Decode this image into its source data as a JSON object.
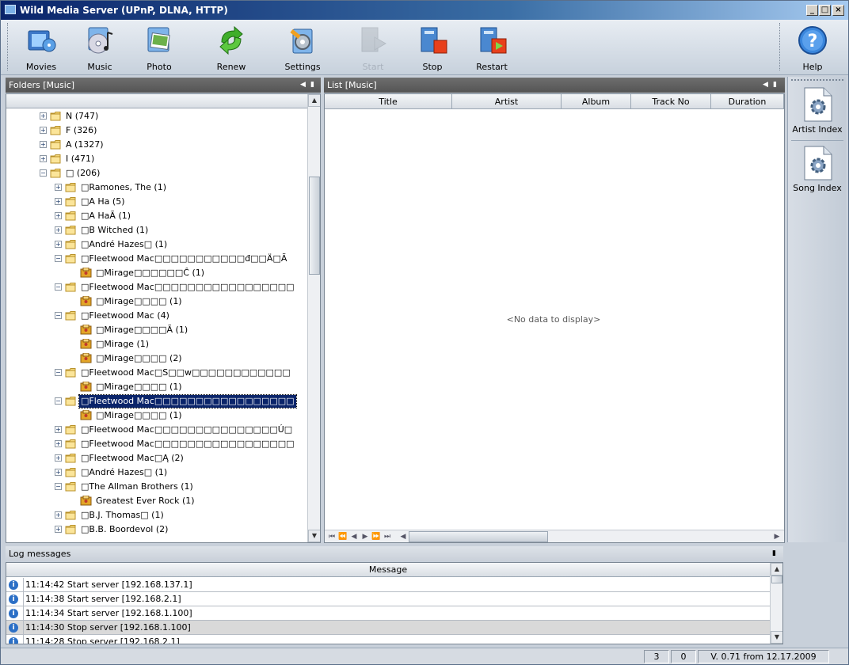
{
  "window": {
    "title": "Wild Media Server (UPnP, DLNA, HTTP)",
    "min_label": "_",
    "max_label": "□",
    "close_label": "×"
  },
  "toolbar": {
    "items": [
      {
        "label": "Movies",
        "icon": "film-icon",
        "enabled": true
      },
      {
        "label": "Music",
        "icon": "music-disc-icon",
        "enabled": true
      },
      {
        "label": "Photo",
        "icon": "photo-icon",
        "enabled": true
      },
      {
        "label": "Renew",
        "icon": "green-arrows-icon",
        "enabled": true
      },
      {
        "label": "Settings",
        "icon": "settings-wrench-icon",
        "enabled": true
      },
      {
        "label": "Start",
        "icon": "start-play-icon",
        "enabled": false
      },
      {
        "label": "Stop",
        "icon": "stop-icon",
        "enabled": true
      },
      {
        "label": "Restart",
        "icon": "restart-icon",
        "enabled": true
      }
    ],
    "help_label": "Help"
  },
  "folders_panel": {
    "title": "Folders [Music]",
    "rows": [
      {
        "label": "N (747)",
        "expander": "+"
      },
      {
        "label": "F (326)",
        "expander": "+"
      },
      {
        "label": "A (1327)",
        "expander": "+"
      },
      {
        "label": "I (471)",
        "expander": "+"
      },
      {
        "label": "□ (206)",
        "expander": "-"
      },
      {
        "label": "□Ramones, The (1)",
        "expander": "+"
      },
      {
        "label": "□A Ha (5)",
        "expander": "+"
      },
      {
        "label": "□A HaÃ (1)",
        "expander": "+"
      },
      {
        "label": "□B Witched (1)",
        "expander": "+"
      },
      {
        "label": "□André Hazes□ (1)",
        "expander": "+"
      },
      {
        "label": "□Fleetwood Mac□□□□□□□□□□□đ□□Ä□Ã",
        "expander": "-"
      },
      {
        "label": "□Mirage□□□□□□Ĉ (1)",
        "expander": ""
      },
      {
        "label": "□Fleetwood Mac□□□□□□□□□□□□□□□□□",
        "expander": "-"
      },
      {
        "label": "□Mirage□□□□ (1)",
        "expander": ""
      },
      {
        "label": "□Fleetwood Mac (4)",
        "expander": "-"
      },
      {
        "label": "□Mirage□□□□Ã (1)",
        "expander": ""
      },
      {
        "label": "□Mirage (1)",
        "expander": ""
      },
      {
        "label": "□Mirage□□□□ (2)",
        "expander": ""
      },
      {
        "label": "□Fleetwood Mac□S□□w□□□□□□□□□□□□",
        "expander": "-"
      },
      {
        "label": "□Mirage□□□□ (1)",
        "expander": ""
      },
      {
        "label": "□Fleetwood Mac□□□□□□□□□□□□□□□□□",
        "expander": "-"
      },
      {
        "label": "□Mirage□□□□ (1)",
        "expander": ""
      },
      {
        "label": "□Fleetwood Mac□□□□□□□□□□□□□□□Ú□",
        "expander": "+"
      },
      {
        "label": "□Fleetwood Mac□□□□□□□□□□□□□□□□□",
        "expander": "+"
      },
      {
        "label": "□Fleetwood Mac□Ą (2)",
        "expander": "+"
      },
      {
        "label": "□André Hazes□ (1)",
        "expander": "+"
      },
      {
        "label": "□The Allman Brothers (1)",
        "expander": "-"
      },
      {
        "label": "Greatest Ever Rock (1)",
        "expander": ""
      },
      {
        "label": "□B.J. Thomas□ (1)",
        "expander": "+"
      },
      {
        "label": "□B.B. Boordevol (2)",
        "expander": "+"
      }
    ]
  },
  "list_panel": {
    "title": "List [Music]",
    "columns": [
      "Title",
      "Artist",
      "Album",
      "Track No",
      "Duration"
    ],
    "empty_text": "<No data to display>"
  },
  "sidebar": {
    "items": [
      {
        "label": "Artist Index"
      },
      {
        "label": "Song Index"
      }
    ]
  },
  "log_panel": {
    "title": "Log messages",
    "column": "Message",
    "rows": [
      "11:14:42 Start server [192.168.137.1]",
      "11:14:38 Start server [192.168.2.1]",
      "11:14:34 Start server [192.168.1.100]",
      "11:14:30 Stop server [192.168.1.100]",
      "11:14:28 Stop server [192.168.2.1]"
    ]
  },
  "statusbar": {
    "count_a": "3",
    "count_b": "0",
    "version": "V. 0.71 from 12.17.2009"
  }
}
